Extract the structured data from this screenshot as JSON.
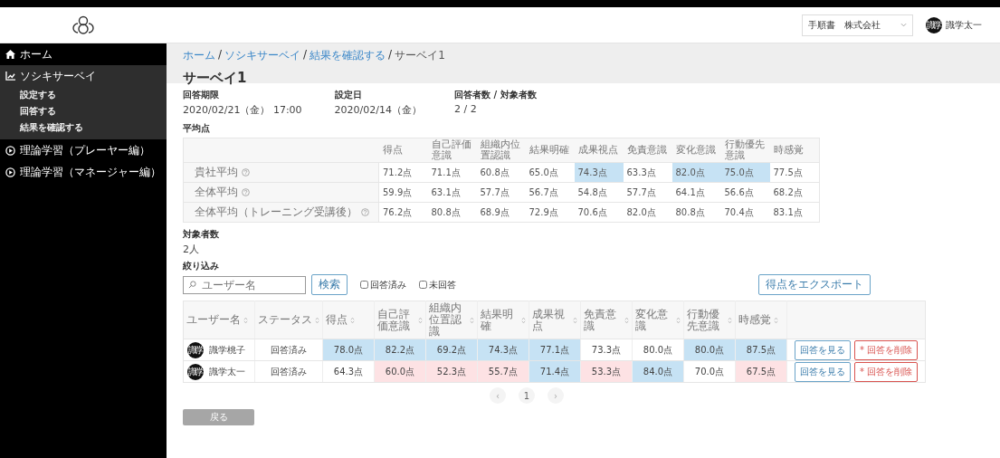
{
  "header": {
    "company_select": {
      "value": "手順書　株式会社"
    },
    "user": {
      "avatar": "識学",
      "name": "識学太一"
    }
  },
  "sidebar": {
    "items": [
      {
        "kind": "home",
        "label": "ホーム",
        "expanded": false
      },
      {
        "kind": "chart",
        "label": "ソシキサーベイ",
        "expanded": true,
        "children": [
          {
            "label": "設定する"
          },
          {
            "label": "回答する"
          },
          {
            "label": "結果を確認する"
          }
        ]
      },
      {
        "kind": "play",
        "label": "理論学習（プレーヤー編）",
        "expanded": false
      },
      {
        "kind": "play",
        "label": "理論学習（マネージャー編）",
        "expanded": false
      }
    ]
  },
  "breadcrumb": {
    "separator": "/",
    "items": [
      {
        "label": "ホーム",
        "link": true
      },
      {
        "label": "ソシキサーベイ",
        "link": true
      },
      {
        "label": "結果を確認する",
        "link": true
      },
      {
        "label": "サーベイ1",
        "link": false
      }
    ]
  },
  "title": "サーベイ1",
  "info": [
    {
      "label": "回答期限",
      "value": "2020/02/21（金） 17:00"
    },
    {
      "label": "設定日",
      "value": "2020/02/14（金）"
    },
    {
      "label": "回答者数 / 対象者数",
      "value": "2 / 2"
    }
  ],
  "averages": {
    "label": "平均点",
    "columns": [
      "得点",
      "自己評価意識",
      "組織内位置認識",
      "結果明確",
      "成果視点",
      "免責意識",
      "変化意識",
      "行動優先意識",
      "時感覚"
    ],
    "rows": [
      {
        "label": "貴社平均",
        "cells": [
          {
            "value": "71.2点",
            "color": "#ffffff"
          },
          {
            "value": "71.1点",
            "color": "#ffffff"
          },
          {
            "value": "60.8点",
            "color": "#ffffff"
          },
          {
            "value": "65.0点",
            "color": "#ffffff"
          },
          {
            "value": "74.3点",
            "color": "#c6e2f4"
          },
          {
            "value": "63.3点",
            "color": "#ffffff"
          },
          {
            "value": "82.0点",
            "color": "#c6e2f4"
          },
          {
            "value": "75.0点",
            "color": "#c6e2f4"
          },
          {
            "value": "77.5点",
            "color": "#ffffff"
          }
        ]
      },
      {
        "label": "全体平均",
        "cells": [
          {
            "value": "59.9点",
            "color": "#ffffff"
          },
          {
            "value": "63.1点",
            "color": "#ffffff"
          },
          {
            "value": "57.7点",
            "color": "#ffffff"
          },
          {
            "value": "56.7点",
            "color": "#ffffff"
          },
          {
            "value": "54.8点",
            "color": "#ffffff"
          },
          {
            "value": "57.7点",
            "color": "#ffffff"
          },
          {
            "value": "64.1点",
            "color": "#ffffff"
          },
          {
            "value": "56.6点",
            "color": "#ffffff"
          },
          {
            "value": "68.2点",
            "color": "#ffffff"
          }
        ]
      },
      {
        "label": "全体平均（トレーニング受講後）",
        "cells": [
          {
            "value": "76.2点",
            "color": "#ffffff"
          },
          {
            "value": "80.8点",
            "color": "#ffffff"
          },
          {
            "value": "68.9点",
            "color": "#ffffff"
          },
          {
            "value": "72.9点",
            "color": "#ffffff"
          },
          {
            "value": "70.6点",
            "color": "#ffffff"
          },
          {
            "value": "82.0点",
            "color": "#ffffff"
          },
          {
            "value": "80.8点",
            "color": "#ffffff"
          },
          {
            "value": "70.4点",
            "color": "#ffffff"
          },
          {
            "value": "83.1点",
            "color": "#ffffff"
          }
        ]
      }
    ]
  },
  "targets": {
    "label": "対象者数",
    "value": "2人"
  },
  "filter": {
    "label": "絞り込み",
    "search": {
      "placeholder": "ユーザー名",
      "button": "検索"
    },
    "checkboxes": [
      {
        "label": "回答済み",
        "checked": false
      },
      {
        "label": "未回答",
        "checked": false
      }
    ],
    "export_button": "得点をエクスポート"
  },
  "results": {
    "columns": [
      "ユーザー名",
      "ステータス",
      "得点",
      "自己評価意識",
      "組織内位置認識",
      "結果明確",
      "成果視点",
      "免責意識",
      "変化意識",
      "行動優先意識",
      "時感覚"
    ],
    "rows": [
      {
        "avatar": "識学",
        "name": "識学桃子",
        "status": "回答済み",
        "scores": [
          {
            "value": "78.0点",
            "color": "#c6e2f4"
          },
          {
            "value": "82.2点",
            "color": "#c6e2f4"
          },
          {
            "value": "69.2点",
            "color": "#c6e2f4"
          },
          {
            "value": "74.3点",
            "color": "#c6e2f4"
          },
          {
            "value": "77.1点",
            "color": "#c6e2f4"
          },
          {
            "value": "73.3点",
            "color": "#ffffff"
          },
          {
            "value": "80.0点",
            "color": "#ffffff"
          },
          {
            "value": "80.0点",
            "color": "#c6e2f4"
          },
          {
            "value": "87.5点",
            "color": "#c6e2f4"
          }
        ],
        "view_button": "回答を見る",
        "delete_button": "* 回答を削除"
      },
      {
        "avatar": "識学",
        "name": "識学太一",
        "status": "回答済み",
        "scores": [
          {
            "value": "64.3点",
            "color": "#ffffff"
          },
          {
            "value": "60.0点",
            "color": "#fde2e4"
          },
          {
            "value": "52.3点",
            "color": "#fde2e4"
          },
          {
            "value": "55.7点",
            "color": "#fde2e4"
          },
          {
            "value": "71.4点",
            "color": "#c6e2f4"
          },
          {
            "value": "53.3点",
            "color": "#fde2e4"
          },
          {
            "value": "84.0点",
            "color": "#c6e2f4"
          },
          {
            "value": "70.0点",
            "color": "#ffffff"
          },
          {
            "value": "67.5点",
            "color": "#fde2e4"
          }
        ],
        "view_button": "回答を見る",
        "delete_button": "* 回答を削除"
      }
    ]
  },
  "pagination": {
    "prev": "‹",
    "pages": [
      {
        "label": "1",
        "selected": true
      }
    ],
    "next": "›"
  },
  "back_button": "戻る"
}
